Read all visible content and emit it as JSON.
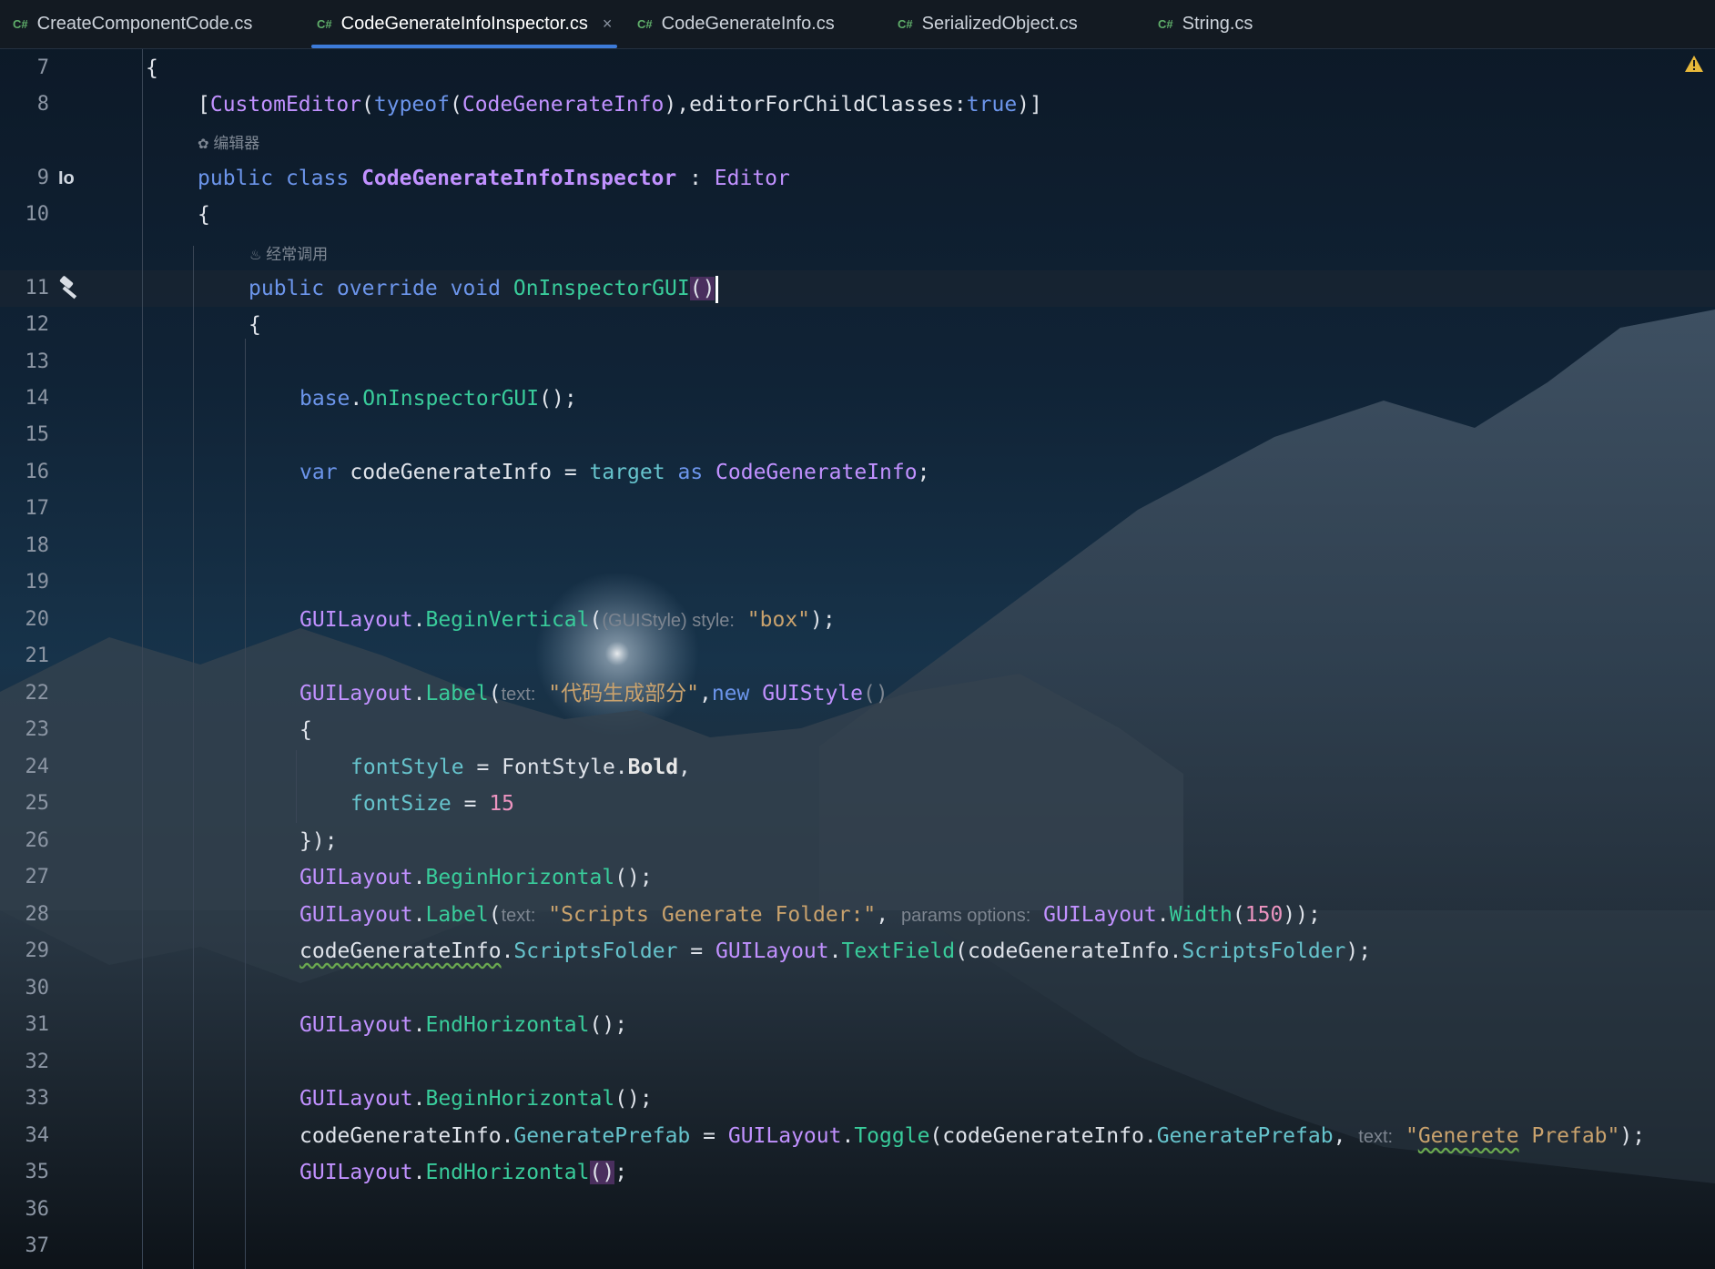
{
  "tabs": [
    {
      "lang": "C#",
      "label": "CreateComponentCode.cs",
      "active": false
    },
    {
      "lang": "C#",
      "label": "CodeGenerateInfoInspector.cs",
      "active": true,
      "close": "×"
    },
    {
      "lang": "C#",
      "label": "CodeGenerateInfo.cs",
      "active": false
    },
    {
      "lang": "C#",
      "label": "SerializedObject.cs",
      "active": false
    },
    {
      "lang": "C#",
      "label": "String.cs",
      "active": false
    }
  ],
  "hints": {
    "editor_usage": "编辑器",
    "frequent_call": "经常调用"
  },
  "gutter_icons": {
    "line9": "implementations-io-icon",
    "line9_text": "Io",
    "line11": "hammer-icon",
    "warning": "warning-icon"
  },
  "lines": {
    "l7": {
      "n": "7"
    },
    "l8": {
      "n": "8"
    },
    "l9": {
      "n": "9"
    },
    "l10": {
      "n": "10"
    },
    "l11": {
      "n": "11"
    },
    "l12": {
      "n": "12"
    },
    "l13": {
      "n": "13"
    },
    "l14": {
      "n": "14"
    },
    "l15": {
      "n": "15"
    },
    "l16": {
      "n": "16"
    },
    "l17": {
      "n": "17"
    },
    "l18": {
      "n": "18"
    },
    "l19": {
      "n": "19"
    },
    "l20": {
      "n": "20"
    },
    "l21": {
      "n": "21"
    },
    "l22": {
      "n": "22"
    },
    "l23": {
      "n": "23"
    },
    "l24": {
      "n": "24"
    },
    "l25": {
      "n": "25"
    },
    "l26": {
      "n": "26"
    },
    "l27": {
      "n": "27"
    },
    "l28": {
      "n": "28"
    },
    "l29": {
      "n": "29"
    },
    "l30": {
      "n": "30"
    },
    "l31": {
      "n": "31"
    },
    "l32": {
      "n": "32"
    },
    "l33": {
      "n": "33"
    },
    "l34": {
      "n": "34"
    },
    "l35": {
      "n": "35"
    },
    "l36": {
      "n": "36"
    },
    "l37": {
      "n": "37"
    }
  },
  "tok": {
    "brace_open": "{",
    "lbr": "[",
    "rbr": "]",
    "lp": "(",
    "rp": ")",
    "comma": ",",
    "colon": ":",
    "dot": ".",
    "semi": ";",
    "eq": " = ",
    "space": " ",
    "CustomEditor": "CustomEditor",
    "typeof": "typeof",
    "CodeGenerateInfo": "CodeGenerateInfo",
    "editorForChildClasses": "editorForChildClasses",
    "true": "true",
    "public": "public",
    "class": "class",
    "CodeGenerateInfoInspector": "CodeGenerateInfoInspector",
    "colon_sep": " : ",
    "Editor": "Editor",
    "override": "override",
    "void": "void",
    "OnInspectorGUI": "OnInspectorGUI",
    "base": "base",
    "var": "var",
    "codeGenerateInfo": "codeGenerateInfo",
    "target": "target",
    "as": "as",
    "GUILayout": "GUILayout",
    "BeginVertical": "BeginVertical",
    "hint_guistyle": "(GUIStyle) style:",
    "box_str": "\"box\"",
    "close_paren_semi": ");",
    "Label": "Label",
    "hint_text": "text:",
    "label_str_cn": "\"代码生成部分\"",
    "new": "new",
    "GUIStyle": "GUIStyle",
    "empty_parens": "()",
    "fontStyle": "fontStyle",
    "FontStyle": "FontStyle",
    "Bold": "Bold",
    "fontSize": "fontSize",
    "n15": "15",
    "close_init": "});",
    "BeginHorizontal": "BeginHorizontal",
    "call_semi": "();",
    "scripts_str": "\"Scripts Generate Folder:\"",
    "hint_params": "params options:",
    "Width": "Width",
    "n150": "150",
    "close_double": "));",
    "ScriptsFolder": "ScriptsFolder",
    "TextField": "TextField",
    "EndHorizontal": "EndHorizontal",
    "GeneratePrefab": "GeneratePrefab",
    "Toggle": "Toggle",
    "q": "\"",
    "Generete": "Generete",
    "Prefab_end": " Prefab\""
  }
}
